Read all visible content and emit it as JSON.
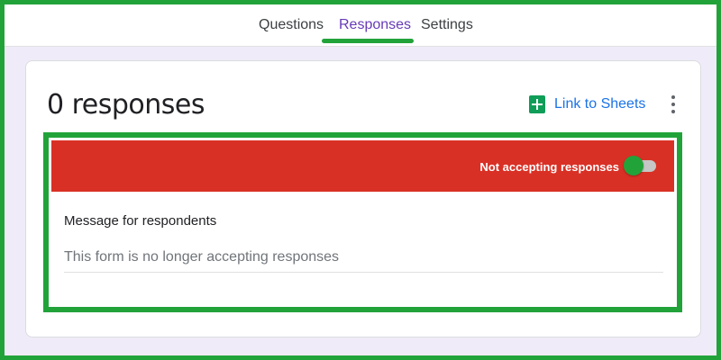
{
  "tabs": [
    {
      "label": "Questions",
      "active": false
    },
    {
      "label": "Responses",
      "active": true
    },
    {
      "label": "Settings",
      "active": false
    }
  ],
  "responses": {
    "count_title": "0 responses",
    "link_to_sheets_label": "Link to Sheets",
    "sheets_icon": "google-sheets-icon",
    "more_icon": "more-vert-icon"
  },
  "accepting": {
    "status_label": "Not accepting responses",
    "toggle_state": "off"
  },
  "message": {
    "label": "Message for respondents",
    "value": "This form is no longer accepting responses"
  },
  "colors": {
    "accent_purple": "#673ab7",
    "banner_red": "#d93025",
    "highlight_green": "#22a33a",
    "link_blue": "#1a73e8",
    "sheets_green": "#0f9d58"
  }
}
